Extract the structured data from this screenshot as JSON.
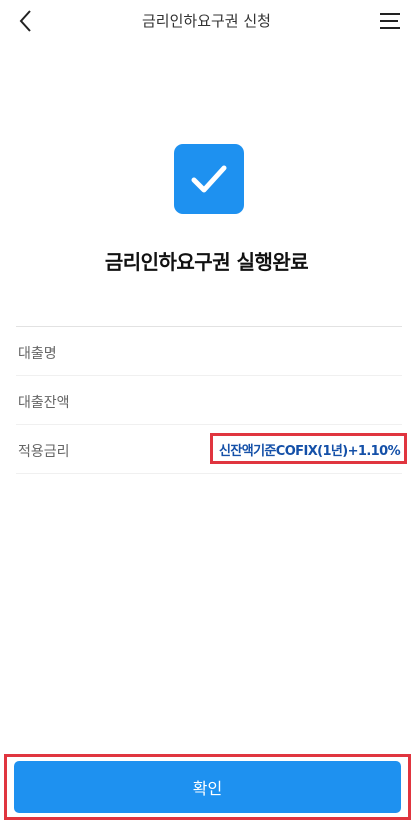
{
  "header": {
    "title": "금리인하요구권 신청",
    "back_icon": "chevron-left-icon",
    "menu_icon": "hamburger-menu-icon"
  },
  "status": {
    "icon": "checkbox-checked-icon",
    "title": "금리인하요구권 실행완료"
  },
  "info": {
    "rows": [
      {
        "label": "대출명",
        "value": ""
      },
      {
        "label": "대출잔액",
        "value": ""
      },
      {
        "label": "적용금리",
        "value": "신잔액기준COFIX(1년)+1.10%"
      }
    ]
  },
  "footer": {
    "confirm_label": "확인"
  },
  "colors": {
    "accent": "#1e91f0",
    "rate_text": "#1450a8",
    "highlight": "#e0353f"
  }
}
